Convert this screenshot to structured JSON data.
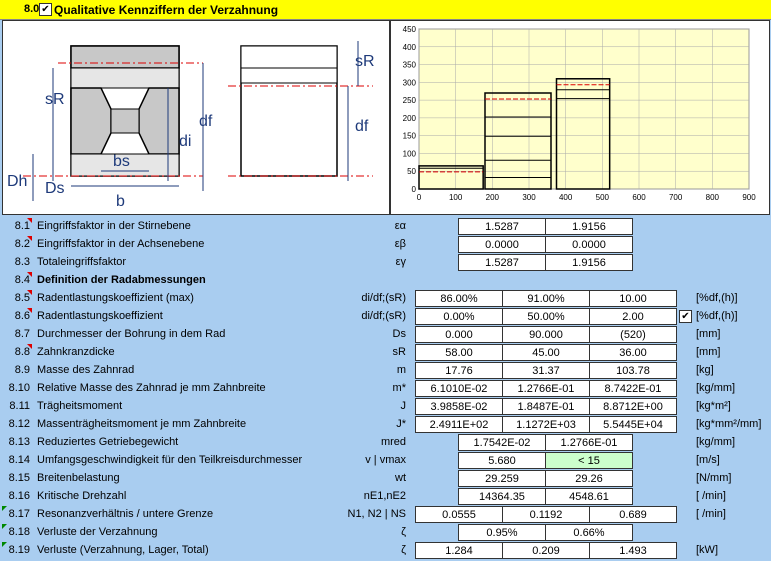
{
  "section": {
    "number": "8.0",
    "title": "Qualitative Kennziffern der Verzahnung",
    "checked": "✔"
  },
  "drawing_labels": {
    "sR_left": "sR",
    "sR_right": "sR",
    "Dh": "Dh",
    "Ds": "Ds",
    "bs": "bs",
    "b": "b",
    "di": "di",
    "df_left": "df",
    "df_right": "df"
  },
  "chart_data": {
    "type": "bar",
    "xlim": [
      0,
      900
    ],
    "ylim": [
      0,
      450
    ],
    "x_ticks": [
      "0",
      "100",
      "200",
      "300",
      "400",
      "500",
      "600",
      "700",
      "800",
      "900"
    ],
    "y_ticks": [
      "0",
      "50",
      "100",
      "150",
      "200",
      "250",
      "300",
      "350",
      "400",
      "450"
    ],
    "boxes": [
      {
        "x0": 0,
        "x1": 175,
        "y": 65
      },
      {
        "x0": 180,
        "x1": 360,
        "y": 270
      },
      {
        "x0": 375,
        "x1": 520,
        "y": 310
      }
    ]
  },
  "rows": [
    {
      "num": "8.1",
      "label": "Eingriffsfaktor in der Stirnebene",
      "sym": "εα",
      "cells": [
        "1.5287",
        "1.9156"
      ],
      "unit": "",
      "flag": "red"
    },
    {
      "num": "8.2",
      "label": "Eingriffsfaktor in der Achsenebene",
      "sym": "εβ",
      "cells": [
        "0.0000",
        "0.0000"
      ],
      "unit": "",
      "flag": "red"
    },
    {
      "num": "8.3",
      "label": "Totaleingriffsfaktor",
      "sym": "εγ",
      "cells": [
        "1.5287",
        "1.9156"
      ],
      "unit": "",
      "flag": ""
    },
    {
      "num": "8.4",
      "label": "Definition der Radabmessungen",
      "sym": "",
      "cells": [],
      "unit": "",
      "flag": "red",
      "section": true
    },
    {
      "num": "8.5",
      "label": "Radentlastungskoeffizient (max)",
      "sym": "di/df;(sR)",
      "cells": [
        "86.00%",
        "91.00%",
        "10.00"
      ],
      "unit": "[%df,(h)]",
      "flag": "red"
    },
    {
      "num": "8.6",
      "label": "Radentlastungskoeffizient",
      "sym": "di/df;(sR)",
      "cells": [
        "0.00%",
        "50.00%",
        "2.00"
      ],
      "unit": "[%df,(h)]",
      "flag": "red",
      "check": "✔"
    },
    {
      "num": "8.7",
      "label": "Durchmesser der Bohrung in dem Rad",
      "sym": "Ds",
      "cells": [
        "0.000",
        "90.000",
        "(520)"
      ],
      "unit": "[mm]",
      "flag": ""
    },
    {
      "num": "8.8",
      "label": "Zahnkranzdicke",
      "sym": "sR",
      "cells": [
        "58.00",
        "45.00",
        "36.00"
      ],
      "unit": "[mm]",
      "flag": "red"
    },
    {
      "num": "8.9",
      "label": "Masse des Zahnrad",
      "sym": "m",
      "cells": [
        "17.76",
        "31.37",
        "103.78"
      ],
      "unit": "[kg]",
      "flag": ""
    },
    {
      "num": "8.10",
      "label": "Relative Masse des Zahnrad je mm Zahnbreite",
      "sym": "m*",
      "cells": [
        "6.1010E-02",
        "1.2766E-01",
        "8.7422E-01"
      ],
      "unit": "[kg/mm]",
      "flag": ""
    },
    {
      "num": "8.11",
      "label": "Trägheitsmoment",
      "sym": "J",
      "cells": [
        "3.9858E-02",
        "1.8487E-01",
        "8.8712E+00"
      ],
      "unit": "[kg*m²]",
      "flag": ""
    },
    {
      "num": "8.12",
      "label": "Massenträgheitsmoment je mm Zahnbreite",
      "sym": "J*",
      "cells": [
        "2.4911E+02",
        "1.1272E+03",
        "5.5445E+04"
      ],
      "unit": "[kg*mm²/mm]",
      "flag": ""
    },
    {
      "num": "8.13",
      "label": "Reduziertes Getriebegewicht",
      "sym": "mred",
      "cells": [
        "1.7542E-02",
        "1.2766E-01"
      ],
      "unit": "[kg/mm]",
      "flag": ""
    },
    {
      "num": "8.14",
      "label": "Umfangsgeschwindigkeit für den Teilkreisdurchmesser",
      "sym": "v | vmax",
      "cells": [
        "5.680",
        "< 15"
      ],
      "unit": "[m/s]",
      "flag": ""
    },
    {
      "num": "8.15",
      "label": "Breitenbelastung",
      "sym": "wt",
      "cells": [
        "29.259",
        "29.26"
      ],
      "unit": "[N/mm]",
      "flag": ""
    },
    {
      "num": "8.16",
      "label": "Kritische Drehzahl",
      "sym": "nE1,nE2",
      "cells": [
        "14364.35",
        "4548.61"
      ],
      "unit": "[ /min]",
      "flag": ""
    },
    {
      "num": "8.17",
      "label": "Resonanzverhältnis / untere Grenze",
      "sym": "N1, N2 | NS",
      "cells": [
        "0.0555",
        "0.1192",
        "0.689"
      ],
      "unit": "[ /min]",
      "flag": "green"
    },
    {
      "num": "8.18",
      "label": "Verluste der Verzahnung",
      "sym": "ζ",
      "cells": [
        "0.95%",
        "0.66%"
      ],
      "unit": "",
      "flag": "green"
    },
    {
      "num": "8.19",
      "label": "Verluste (Verzahnung, Lager, Total)",
      "sym": "ζ",
      "cells": [
        "1.284",
        "0.209",
        "1.493"
      ],
      "unit": "[kW]",
      "flag": "green"
    }
  ]
}
